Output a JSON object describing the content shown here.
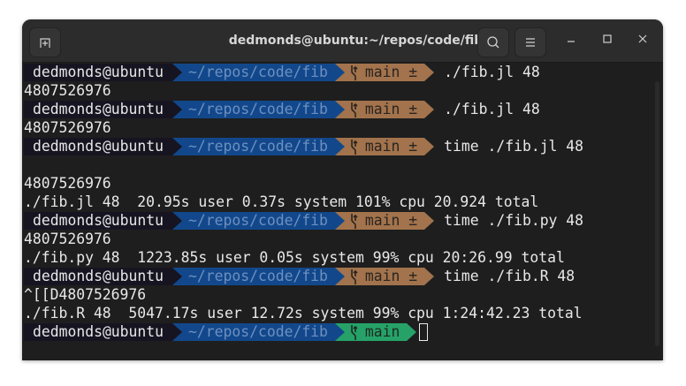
{
  "window": {
    "title": "dedmonds@ubuntu:~/repos/code/fib"
  },
  "prompt": {
    "user": "dedmonds@ubuntu",
    "path": "~/repos/code/fib",
    "branch_dirty": "main ±",
    "branch_clean": "main"
  },
  "lines": [
    {
      "type": "prompt",
      "dirty": true,
      "cmd": "./fib.jl 48"
    },
    {
      "type": "out",
      "text": "4807526976"
    },
    {
      "type": "prompt",
      "dirty": true,
      "cmd": "./fib.jl 48"
    },
    {
      "type": "out",
      "text": "4807526976"
    },
    {
      "type": "prompt",
      "dirty": true,
      "cmd": "time ./fib.jl 48"
    },
    {
      "type": "out",
      "text": ""
    },
    {
      "type": "out",
      "text": "4807526976"
    },
    {
      "type": "out",
      "text": "./fib.jl 48  20.95s user 0.37s system 101% cpu 20.924 total"
    },
    {
      "type": "prompt",
      "dirty": true,
      "cmd": "time ./fib.py 48"
    },
    {
      "type": "out",
      "text": "4807526976"
    },
    {
      "type": "out",
      "text": "./fib.py 48  1223.85s user 0.05s system 99% cpu 20:26.99 total"
    },
    {
      "type": "prompt",
      "dirty": true,
      "cmd": "time ./fib.R 48"
    },
    {
      "type": "out",
      "text": "^[[D4807526976"
    },
    {
      "type": "out",
      "text": "./fib.R 48  5047.17s user 12.72s system 99% cpu 1:24:42.23 total"
    },
    {
      "type": "prompt",
      "dirty": false,
      "cmd": ""
    }
  ],
  "colors": {
    "user_bg": "#171421",
    "path_bg": "#12488b",
    "git_dirty_bg": "#a2734c",
    "git_clean_bg": "#26a269"
  }
}
